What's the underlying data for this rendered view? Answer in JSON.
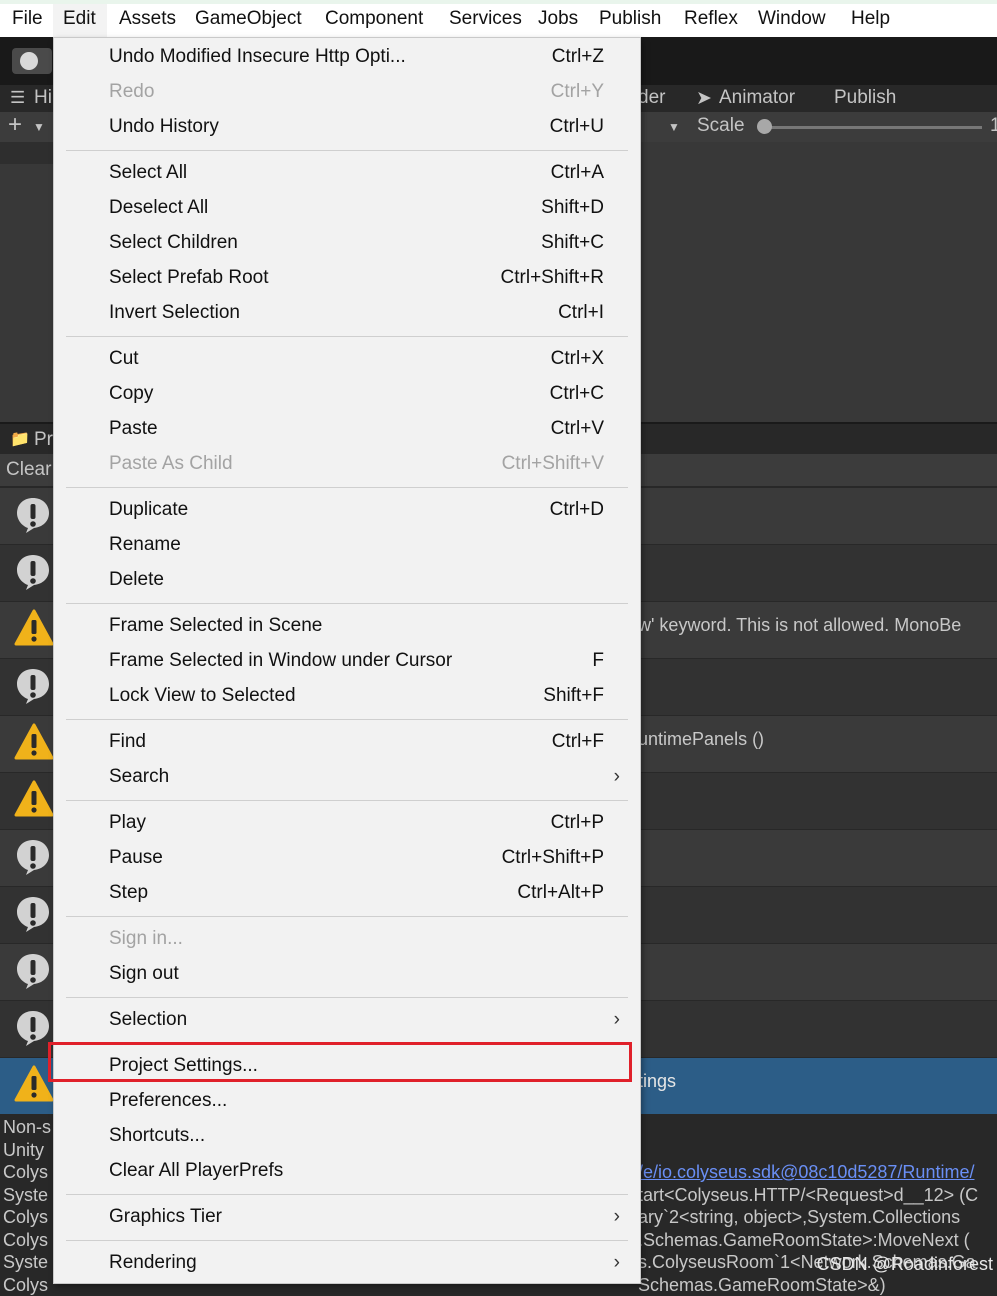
{
  "menubar": [
    "File",
    "Edit",
    "Assets",
    "GameObject",
    "Component",
    "Services",
    "Jobs",
    "Publish",
    "Reflex",
    "Window",
    "Help"
  ],
  "background": {
    "tabs": {
      "hierarchy_fragment": "Hi",
      "shader_fragment": "der",
      "animator": "Animator",
      "publish": "Publish"
    },
    "scale_label": "Scale",
    "scale_fragment": "1",
    "project_fragment": "Pr",
    "clear_fragment": "Clear",
    "console_rows": [
      {
        "type": "info",
        "text": ""
      },
      {
        "type": "info",
        "text": ""
      },
      {
        "type": "warn",
        "text": "w' keyword.  This is not allowed.  MonoBe"
      },
      {
        "type": "info",
        "text": ""
      },
      {
        "type": "warn",
        "text": "untimePanels ()"
      },
      {
        "type": "warn",
        "text": ""
      },
      {
        "type": "info",
        "text": ""
      },
      {
        "type": "info",
        "text": ""
      },
      {
        "type": "info",
        "text": ""
      },
      {
        "type": "info",
        "text": ""
      },
      {
        "type": "warn",
        "text": "tings",
        "selected": true
      }
    ],
    "stack_left": [
      "Non-s",
      "Unity",
      "Colys",
      "Syste",
      "Colys",
      "Colys",
      "Syste",
      "Colys"
    ],
    "stack_right": [
      "",
      "",
      "/e/io.colyseus.sdk@08c10d5287/Runtime/",
      "tart<Colyseus.HTTP/<Request>d__12> (C",
      "ary`2<string, object>,System.Collections",
      ".Schemas.GameRoomState>:MoveNext (",
      "s.ColyseusRoom`1<Network.Schemas.Ga",
      "Schemas.GameRoomState>&)"
    ],
    "watermark": "CSDN @Roadinforest"
  },
  "edit_menu": {
    "groups": [
      [
        {
          "label": "Undo Modified Insecure Http Opti...",
          "shortcut": "Ctrl+Z"
        },
        {
          "label": "Redo",
          "shortcut": "Ctrl+Y",
          "disabled": true
        },
        {
          "label": "Undo History",
          "shortcut": "Ctrl+U"
        }
      ],
      [
        {
          "label": "Select All",
          "shortcut": "Ctrl+A"
        },
        {
          "label": "Deselect All",
          "shortcut": "Shift+D"
        },
        {
          "label": "Select Children",
          "shortcut": "Shift+C"
        },
        {
          "label": "Select Prefab Root",
          "shortcut": "Ctrl+Shift+R"
        },
        {
          "label": "Invert Selection",
          "shortcut": "Ctrl+I"
        }
      ],
      [
        {
          "label": "Cut",
          "shortcut": "Ctrl+X"
        },
        {
          "label": "Copy",
          "shortcut": "Ctrl+C"
        },
        {
          "label": "Paste",
          "shortcut": "Ctrl+V"
        },
        {
          "label": "Paste As Child",
          "shortcut": "Ctrl+Shift+V",
          "disabled": true
        }
      ],
      [
        {
          "label": "Duplicate",
          "shortcut": "Ctrl+D"
        },
        {
          "label": "Rename",
          "shortcut": ""
        },
        {
          "label": "Delete",
          "shortcut": ""
        }
      ],
      [
        {
          "label": "Frame Selected in Scene",
          "shortcut": ""
        },
        {
          "label": "Frame Selected in Window under Cursor",
          "shortcut": "F"
        },
        {
          "label": "Lock View to Selected",
          "shortcut": "Shift+F"
        }
      ],
      [
        {
          "label": "Find",
          "shortcut": "Ctrl+F"
        },
        {
          "label": "Search",
          "shortcut": "",
          "submenu": true
        }
      ],
      [
        {
          "label": "Play",
          "shortcut": "Ctrl+P"
        },
        {
          "label": "Pause",
          "shortcut": "Ctrl+Shift+P"
        },
        {
          "label": "Step",
          "shortcut": "Ctrl+Alt+P"
        }
      ],
      [
        {
          "label": "Sign in...",
          "shortcut": "",
          "disabled": true
        },
        {
          "label": "Sign out",
          "shortcut": ""
        }
      ],
      [
        {
          "label": "Selection",
          "shortcut": "",
          "submenu": true
        }
      ],
      [
        {
          "label": "Project Settings...",
          "shortcut": "",
          "highlighted": true
        },
        {
          "label": "Preferences...",
          "shortcut": ""
        },
        {
          "label": "Shortcuts...",
          "shortcut": ""
        },
        {
          "label": "Clear All PlayerPrefs",
          "shortcut": ""
        }
      ],
      [
        {
          "label": "Graphics Tier",
          "shortcut": "",
          "submenu": true
        }
      ],
      [
        {
          "label": "Rendering",
          "shortcut": "",
          "submenu": true
        }
      ]
    ]
  },
  "colors": {
    "highlight_box": "#e0202a",
    "selected_row": "#2c5d87",
    "link": "#6a8ff5"
  }
}
